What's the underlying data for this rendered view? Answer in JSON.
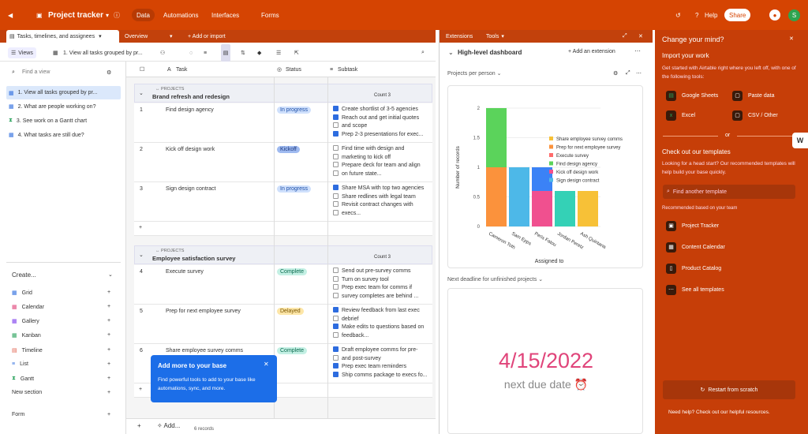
{
  "topbar": {
    "title": "Project tracker",
    "tabs": [
      "Data",
      "Automations",
      "Interfaces",
      "Forms"
    ],
    "help": "Help",
    "share": "Share",
    "avatar": "S"
  },
  "toolbar": {
    "workspace_tab": "Tasks, timelines, and assignees",
    "overview": "Overview",
    "add_import": "+ Add or import"
  },
  "viewbar": {
    "views": "Views",
    "current_view": "1. View all tasks grouped by pr...",
    "search_icon": "search-icon"
  },
  "sidebar": {
    "find_placeholder": "Find a view",
    "views": [
      "1. View all tasks grouped by pr...",
      "2. What are people working on?",
      "3. See work on a Gantt chart",
      "4. What tasks are still due?"
    ],
    "create": "Create...",
    "create_items": [
      "Grid",
      "Calendar",
      "Gallery",
      "Kanban",
      "Timeline",
      "List",
      "Gantt",
      "New section",
      "Form"
    ]
  },
  "grid": {
    "columns": [
      "Task",
      "Status",
      "Subtask"
    ],
    "groups": [
      {
        "label": "PROJECTS",
        "name": "Brand refresh and redesign",
        "count": "Count 3"
      },
      {
        "label": "PROJECTS",
        "name": "Employee satisfaction survey",
        "count": "Count 3"
      }
    ],
    "rows": [
      {
        "n": "1",
        "task": "Find design agency",
        "status": "In progress",
        "subs": [
          {
            "on": true,
            "t": "Create shortlist of 3-5 agencies"
          },
          {
            "on": true,
            "t": "Reach out and get initial quotes"
          },
          {
            "on": false,
            "t": "and scope"
          },
          {
            "on": true,
            "t": "Prep 2-3 presentations for exec..."
          }
        ]
      },
      {
        "n": "2",
        "task": "Kick off design work",
        "status": "Kickoff",
        "subs": [
          {
            "on": false,
            "t": "Find time with design and"
          },
          {
            "on": false,
            "t": "marketing to kick off"
          },
          {
            "on": false,
            "t": "Prepare deck for team and align"
          },
          {
            "on": false,
            "t": "on future state..."
          }
        ]
      },
      {
        "n": "3",
        "task": "Sign design contract",
        "status": "In progress",
        "subs": [
          {
            "on": true,
            "t": "Share MSA with top two agencies"
          },
          {
            "on": false,
            "t": "Share redlines with legal team"
          },
          {
            "on": false,
            "t": "Revisit contract changes with"
          },
          {
            "on": false,
            "t": "execs..."
          }
        ]
      },
      {
        "n": "4",
        "task": "Execute survey",
        "status": "Complete",
        "subs": [
          {
            "on": false,
            "t": "Send out pre-survey comms"
          },
          {
            "on": false,
            "t": "Turn on survey tool"
          },
          {
            "on": false,
            "t": "Prep exec team for comms if"
          },
          {
            "on": false,
            "t": "survey completes are behind ..."
          }
        ]
      },
      {
        "n": "5",
        "task": "Prep for next employee survey",
        "status": "Delayed",
        "subs": [
          {
            "on": true,
            "t": "Review feedback from last exec"
          },
          {
            "on": false,
            "t": "debrief"
          },
          {
            "on": true,
            "t": "Make edits to questions based on"
          },
          {
            "on": false,
            "t": "feedback..."
          }
        ]
      },
      {
        "n": "6",
        "task": "Share employee survey comms",
        "status": "Complete",
        "subs": [
          {
            "on": true,
            "t": "Draft employee comms for pre-"
          },
          {
            "on": false,
            "t": "and post-survey"
          },
          {
            "on": true,
            "t": "Prep exec team reminders"
          },
          {
            "on": true,
            "t": "Ship comms package to execs fo..."
          }
        ]
      }
    ],
    "records": "6 records",
    "add": "Add..."
  },
  "tooltip": {
    "title": "Add more to your base",
    "body": "Find powerful tools to add to your base like automations, sync, and more."
  },
  "extensions": {
    "tab1": "Extensions",
    "tab2": "Tools",
    "dashboard": "High-level dashboard",
    "add_extension": "+ Add an extension",
    "chart_menu": "Projects per person",
    "next_menu": "Next deadline for unfinished projects",
    "due_date": "4/15/2022",
    "due_label": "next due date"
  },
  "chart_data": {
    "type": "bar",
    "xlabel": "Assigned to",
    "ylabel": "Number of records",
    "ylim": [
      0,
      2
    ],
    "yticks": [
      "0",
      "0.5",
      "1",
      "1.5",
      "2"
    ],
    "categories": [
      "Cameron Toth",
      "Sam Epps",
      "Peris Fatou",
      "Jordan Peretz",
      "Ash Quintana"
    ],
    "series": [
      {
        "name": "Share employee survey comms",
        "color": "#f7c137",
        "values": [
          0,
          0,
          0,
          0,
          0.6
        ]
      },
      {
        "name": "Prep for next employee survey",
        "color": "#fb923c",
        "values": [
          1,
          0,
          0,
          0,
          0
        ]
      },
      {
        "name": "Execute survey",
        "color": "#ff6b6b",
        "values": [
          0,
          0,
          0,
          0,
          0
        ]
      },
      {
        "name": "Find design agency",
        "color": "#5bd35b",
        "values": [
          1,
          0,
          0,
          0,
          0
        ]
      },
      {
        "name": "Kick off design work",
        "color": "#f0508f",
        "values": [
          0,
          0,
          0.6,
          0,
          0
        ]
      },
      {
        "name": "Sign design contract",
        "color": "#4db8e8",
        "values": [
          0,
          1,
          0,
          0,
          0
        ]
      }
    ],
    "extra": [
      {
        "cat": 2,
        "color": "#3b82f6",
        "value": 0.4
      },
      {
        "cat": 3,
        "color": "#34d1b6",
        "value": 0.6
      }
    ]
  },
  "rightpanel": {
    "title": "Change your mind?",
    "import": "Import your work",
    "import_desc": "Get started with Airtable right where you left off, with one of the following tools:",
    "tools": [
      "Google Sheets",
      "Paste data",
      "Excel",
      "CSV / Other"
    ],
    "or": "or",
    "templates_title": "Check out our templates",
    "templates_desc": "Looking for a head start? Our recommended templates will help build your base quickly.",
    "find_template": "Find another template",
    "recommended": "Recommended based on your team",
    "templates": [
      "Project Tracker",
      "Content Calendar",
      "Product Catalog",
      "See all templates"
    ],
    "restart": "Restart from scratch",
    "help": "Need help? Check out our helpful resources."
  }
}
